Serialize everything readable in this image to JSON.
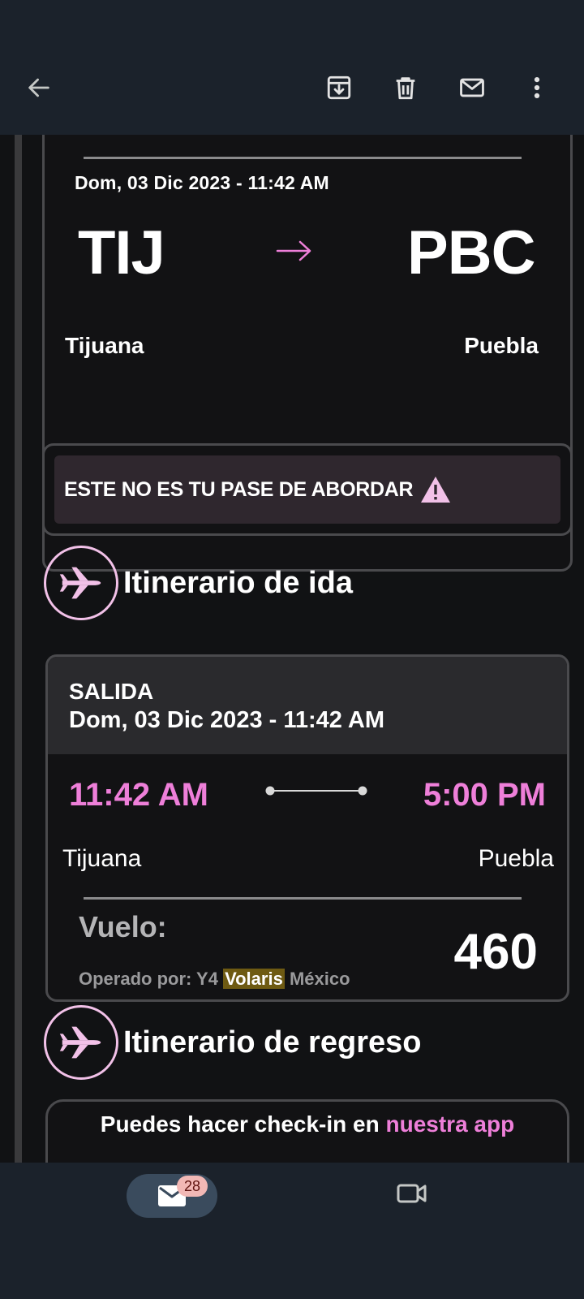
{
  "toolbar": {
    "back_icon": "arrow-left-icon",
    "archive_icon": "archive-icon",
    "delete_icon": "trash-icon",
    "mark_unread_icon": "mail-icon",
    "more_icon": "more-vertical-icon"
  },
  "route": {
    "date": "Dom, 03  Dic  2023 - 11:42 AM",
    "origin_code": "TIJ",
    "destination_code": "PBC",
    "origin_city": "Tijuana",
    "destination_city": "Puebla",
    "arrow_icon": "arrow-right-icon"
  },
  "warning": {
    "text": "ESTE NO ES TU PASE DE ABORDAR",
    "icon": "warning-triangle-icon"
  },
  "outbound": {
    "title": "Itinerario de ida",
    "icon": "airplane-icon",
    "label": "SALIDA",
    "date": "Dom, 03  Dic  2023 - 11:42 AM",
    "depart_time": "11:42 AM",
    "arrive_time": "5:00 PM",
    "depart_city": "Tijuana",
    "arrive_city": "Puebla",
    "flight_label": "Vuelo:",
    "flight_number": "460",
    "operated_prefix": "Operado por: Y4 ",
    "operated_highlight": "Volaris",
    "operated_suffix": " México"
  },
  "return": {
    "title": "Itinerario de regreso",
    "icon": "airplane-icon"
  },
  "checkin": {
    "text": "Puedes hacer check-in en ",
    "link": "nuestra app"
  },
  "bottom_nav": {
    "mail_badge": "28",
    "mail_icon": "mail-icon",
    "meet_icon": "video-camera-icon"
  },
  "colors": {
    "accent_pink": "#ee7fd9",
    "bar_bg": "#1b222b",
    "card_border": "#4a4a4d",
    "highlight": "#6e5a12"
  }
}
